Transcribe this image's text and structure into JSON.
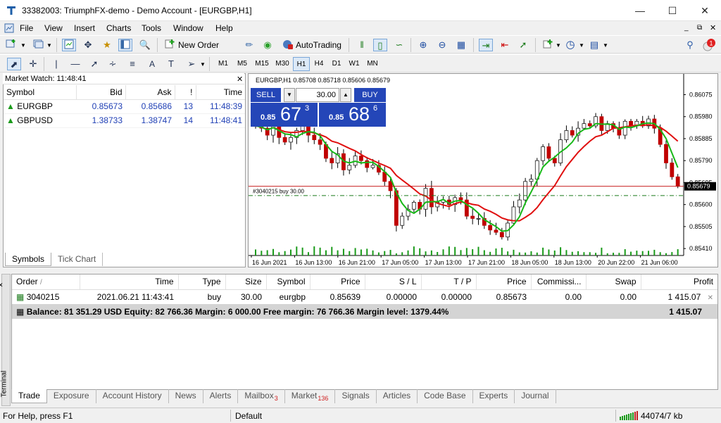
{
  "window": {
    "title": "33382003: TriumphFX-demo - Demo Account - [EURGBP,H1]"
  },
  "menu": [
    "File",
    "View",
    "Insert",
    "Charts",
    "Tools",
    "Window",
    "Help"
  ],
  "toolbar": {
    "new_order": "New Order",
    "autotrading": "AutoTrading"
  },
  "timeframes": [
    "M1",
    "M5",
    "M15",
    "M30",
    "H1",
    "H4",
    "D1",
    "W1",
    "MN"
  ],
  "market_watch": {
    "title": "Market Watch: 11:48:41",
    "columns": [
      "Symbol",
      "Bid",
      "Ask",
      "!",
      "Time"
    ],
    "rows": [
      {
        "symbol": "EURGBP",
        "bid": "0.85673",
        "ask": "0.85686",
        "spread": "13",
        "time": "11:48:39"
      },
      {
        "symbol": "GBPUSD",
        "bid": "1.38733",
        "ask": "1.38747",
        "spread": "14",
        "time": "11:48:41"
      }
    ],
    "tabs": [
      "Symbols",
      "Tick Chart"
    ]
  },
  "chart": {
    "header": "EURGBP,H1  0.85708 0.85718 0.85606 0.85679",
    "sell_label": "SELL",
    "buy_label": "BUY",
    "volume": "30.00",
    "sell_prefix": "0.85",
    "sell_big": "67",
    "sell_sup": "3",
    "buy_prefix": "0.85",
    "buy_big": "68",
    "buy_sup": "6",
    "order_line_label": "#3040215 buy 30.00",
    "current_price": "0.85679"
  },
  "chart_data": {
    "type": "candlestick",
    "y_ticks": [
      "0.86075",
      "0.85980",
      "0.85885",
      "0.85790",
      "0.85695",
      "0.85600",
      "0.85505",
      "0.85410"
    ],
    "x_ticks": [
      "16 Jun 2021",
      "16 Jun 13:00",
      "16 Jun 21:00",
      "17 Jun 05:00",
      "17 Jun 13:00",
      "17 Jun 21:00",
      "18 Jun 05:00",
      "18 Jun 13:00",
      "20 Jun 22:00",
      "21 Jun 06:00"
    ],
    "current_price": 0.85679,
    "order_price": 0.85639,
    "ylim": [
      0.8538,
      0.8611
    ],
    "closes": [
      0.8594,
      0.8593,
      0.859,
      0.8596,
      0.8589,
      0.8587,
      0.8589,
      0.8592,
      0.8595,
      0.859,
      0.8588,
      0.8586,
      0.858,
      0.8578,
      0.8582,
      0.8575,
      0.8577,
      0.8581,
      0.8579,
      0.8576,
      0.8577,
      0.8574,
      0.857,
      0.8566,
      0.8551,
      0.8555,
      0.8558,
      0.8561,
      0.8558,
      0.8567,
      0.8559,
      0.8561,
      0.8562,
      0.856,
      0.8563,
      0.8562,
      0.8555,
      0.8554,
      0.8554,
      0.8551,
      0.8549,
      0.8548,
      0.8546,
      0.8552,
      0.8559,
      0.8562,
      0.857,
      0.8571,
      0.8579,
      0.8585,
      0.858,
      0.8578,
      0.8588,
      0.8592,
      0.859,
      0.8593,
      0.8595,
      0.8594,
      0.8598,
      0.8592,
      0.8595,
      0.8593,
      0.859,
      0.8596,
      0.8594,
      0.8596,
      0.8594,
      0.8597,
      0.8593,
      0.8586,
      0.8578,
      0.8572,
      0.8568
    ]
  },
  "terminal": {
    "columns": [
      "Order",
      "Time",
      "Type",
      "Size",
      "Symbol",
      "Price",
      "S / L",
      "T / P",
      "Price",
      "Commissi...",
      "Swap",
      "Profit"
    ],
    "order": {
      "id": "3040215",
      "time": "2021.06.21 11:43:41",
      "type": "buy",
      "size": "30.00",
      "symbol": "eurgbp",
      "price": "0.85639",
      "sl": "0.00000",
      "tp": "0.00000",
      "cur_price": "0.85673",
      "commission": "0.00",
      "swap": "0.00",
      "profit": "1 415.07"
    },
    "balance_text": "Balance: 81 351.29 USD  Equity: 82 766.36  Margin: 6 000.00  Free margin: 76 766.36  Margin level: 1379.44%",
    "balance_profit": "1 415.07",
    "tabs": [
      {
        "label": "Trade"
      },
      {
        "label": "Exposure"
      },
      {
        "label": "Account History"
      },
      {
        "label": "News"
      },
      {
        "label": "Alerts"
      },
      {
        "label": "Mailbox",
        "badge": "3"
      },
      {
        "label": "Market",
        "badge": "136"
      },
      {
        "label": "Signals"
      },
      {
        "label": "Articles"
      },
      {
        "label": "Code Base"
      },
      {
        "label": "Experts"
      },
      {
        "label": "Journal"
      }
    ],
    "side_label": "Terminal"
  },
  "status": {
    "help": "For Help, press F1",
    "profile": "Default",
    "traffic": "44074/7 kb"
  },
  "colors": {
    "bull": "#1c1c1c",
    "bear": "#c00000",
    "ma_fast": "#18b818",
    "ma_slow": "#e01010",
    "sell_bg": "#2446b8",
    "order_line": "#1a7a1a",
    "price_line": "#c00000"
  }
}
